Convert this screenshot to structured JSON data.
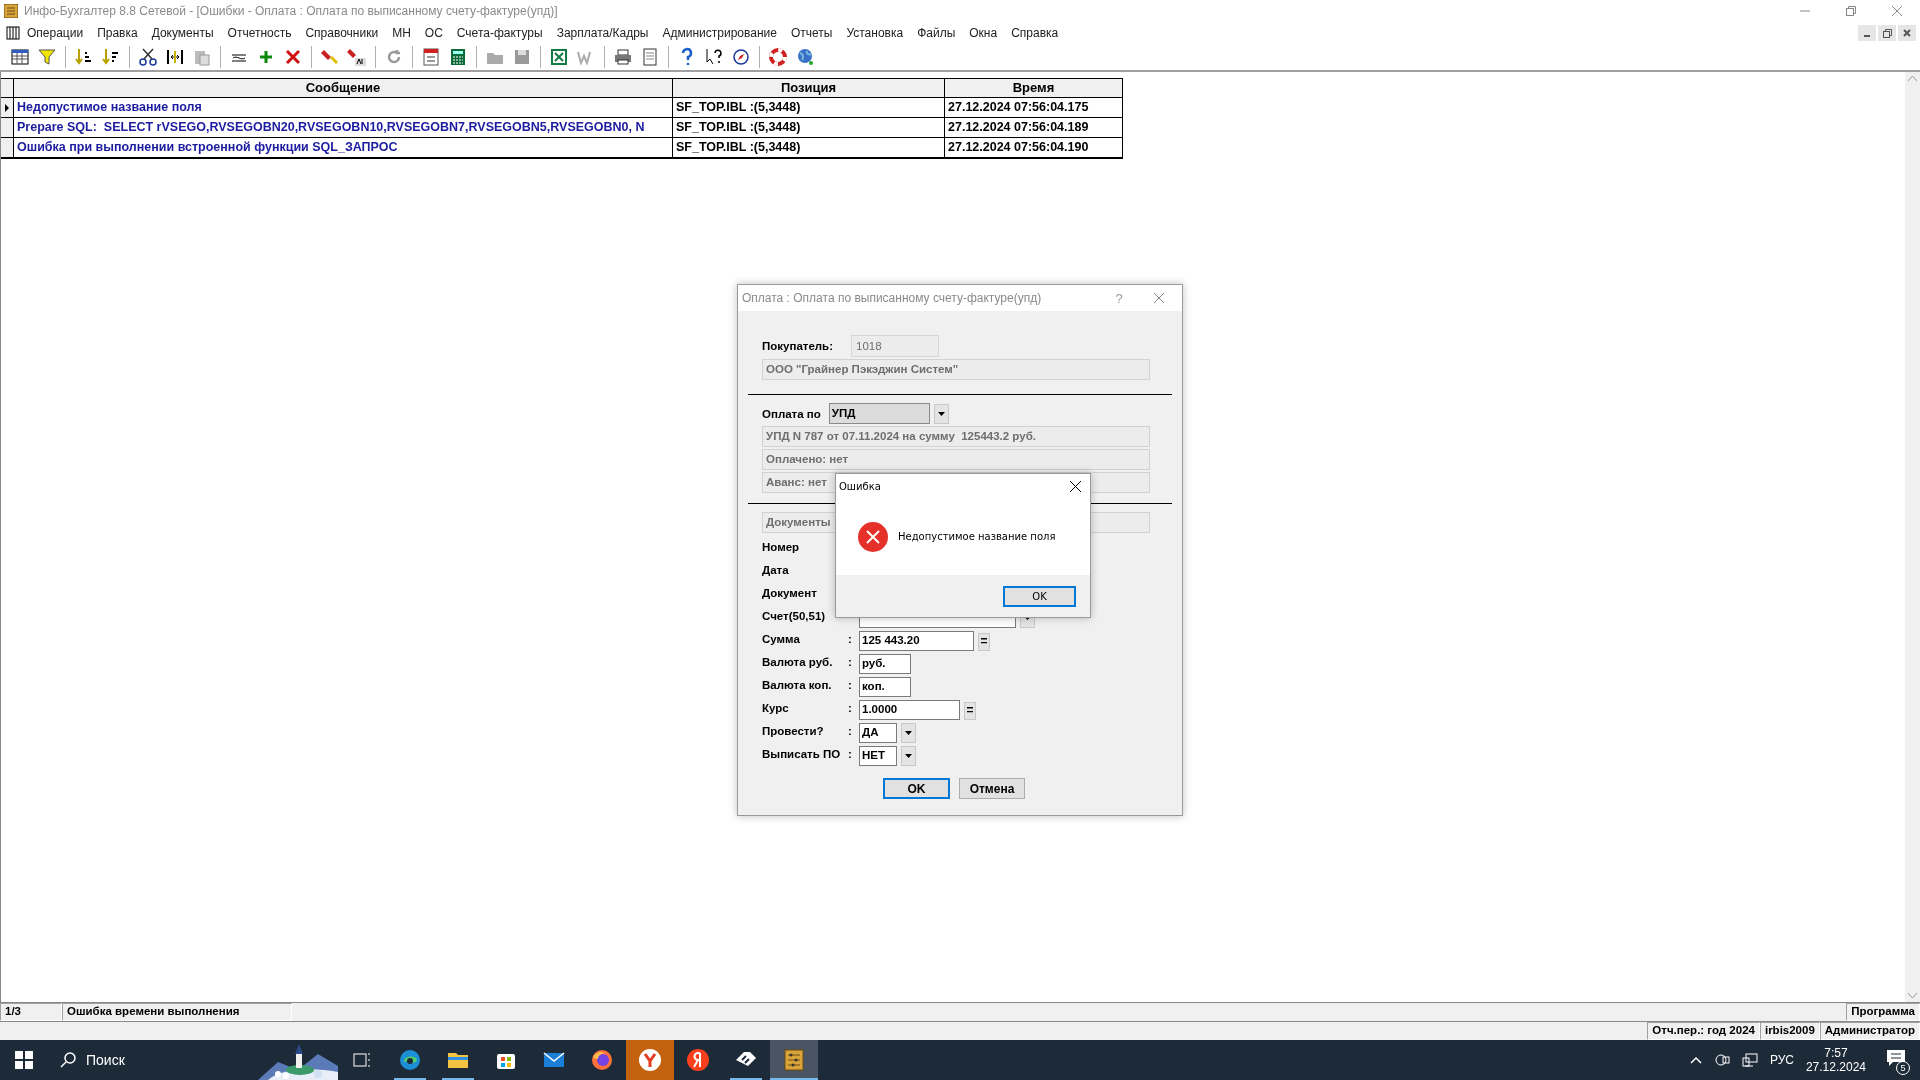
{
  "window": {
    "title": "Инфо-Бухгалтер 8.8 Сетевой - [Ошибки - Оплата : Оплата по выписанному счету-фактуре(упд)]"
  },
  "menu": [
    "Операции",
    "Правка",
    "Документы",
    "Отчетность",
    "Справочники",
    "МН",
    "ОС",
    "Счета-фактуры",
    "Зарплата/Кадры",
    "Администрирование",
    "Отчеты",
    "Установка",
    "Файлы",
    "Окна",
    "Справка"
  ],
  "log_table": {
    "columns": [
      "Сообщение",
      "Позиция",
      "Время"
    ],
    "rows": [
      {
        "selected": true,
        "cells": [
          "Недопустимое название поля",
          "SF_TOP.IBL :(5,3448)",
          "27.12.2024 07:56:04.175"
        ]
      },
      {
        "selected": false,
        "cells": [
          "Prepare SQL:  SELECT rVSEGO,RVSEGOBN20,RVSEGOBN10,RVSEGOBN7,RVSEGOBN5,RVSEGOBN0, N",
          "SF_TOP.IBL :(5,3448)",
          "27.12.2024 07:56:04.189"
        ]
      },
      {
        "selected": false,
        "cells": [
          "Ошибка при выполнении встроенной функции SQL_ЗАПРОС",
          "SF_TOP.IBL :(5,3448)",
          "27.12.2024 07:56:04.190"
        ]
      }
    ]
  },
  "payment_dialog": {
    "title": "Оплата : Оплата по выписанному счету-фактуре(упд)",
    "help": "?",
    "buyer_label": "Покупатель:",
    "buyer_code": "1018",
    "buyer_name": "ООО \"Грайнер Пэкэджин Систем\"",
    "payment_label": "Оплата по",
    "payment_type": "УПД",
    "info_lines": [
      "УПД N 787 от 07.11.2024 на сумму  125443.2 руб.",
      "Оплачено: нет",
      "Аванс: нет"
    ],
    "documents_label": "Документы",
    "form_rows": [
      {
        "label": "Номер",
        "kind": "covered"
      },
      {
        "label": "Дата",
        "kind": "covered"
      },
      {
        "label": "Документ",
        "kind": "covered"
      },
      {
        "label": "Счет(50,51)",
        "kind": "account"
      },
      {
        "label": "Сумма",
        "colon": ":",
        "kind": "amount",
        "value": "125 443.20",
        "button": "="
      },
      {
        "label": "Валюта руб.",
        "colon": ":",
        "kind": "currency",
        "value": "руб."
      },
      {
        "label": "Валюта коп.",
        "colon": ":",
        "kind": "currency",
        "value": "коп."
      },
      {
        "label": "Курс",
        "colon": ":",
        "kind": "rate",
        "value": "1.0000",
        "button": "="
      },
      {
        "label": "Провести?",
        "colon": ":",
        "kind": "choice",
        "value": "ДА"
      },
      {
        "label": "Выписать ПО",
        "colon": ":",
        "kind": "choice",
        "value": "НЕТ"
      }
    ],
    "buttons": [
      {
        "label": "OK",
        "default": true
      },
      {
        "label": "Отмена",
        "default": false
      }
    ]
  },
  "error_box": {
    "title": "Ошибка",
    "message": "Недопустимое название поля",
    "button": "OK"
  },
  "status_bar": {
    "counter": "1/3",
    "message": "Ошибка времени выполнения",
    "mode": "Программа",
    "period": "Отч.пер.: год 2024",
    "database": "irbis2009",
    "user": "Администратор"
  },
  "taskbar": {
    "search_placeholder": "Поиск",
    "apps": [
      {
        "kind": "task-view",
        "running": false,
        "active": false,
        "attention": false
      },
      {
        "kind": "edge",
        "running": true,
        "active": false,
        "attention": false
      },
      {
        "kind": "explorer",
        "running": true,
        "active": false,
        "attention": false
      },
      {
        "kind": "store",
        "running": false,
        "active": false,
        "attention": false
      },
      {
        "kind": "mail",
        "running": false,
        "active": false,
        "attention": false
      },
      {
        "kind": "firefox",
        "running": false,
        "active": false,
        "attention": false
      },
      {
        "kind": "yandex-browser",
        "running": false,
        "active": false,
        "attention": true
      },
      {
        "kind": "yandex",
        "running": false,
        "active": false,
        "attention": false
      },
      {
        "kind": "diamond",
        "running": true,
        "active": false,
        "attention": false
      },
      {
        "kind": "accounting",
        "running": true,
        "active": true,
        "attention": false
      }
    ],
    "language": "РУС",
    "time": "7:57",
    "date": "27.12.2024",
    "notifications": "5"
  }
}
